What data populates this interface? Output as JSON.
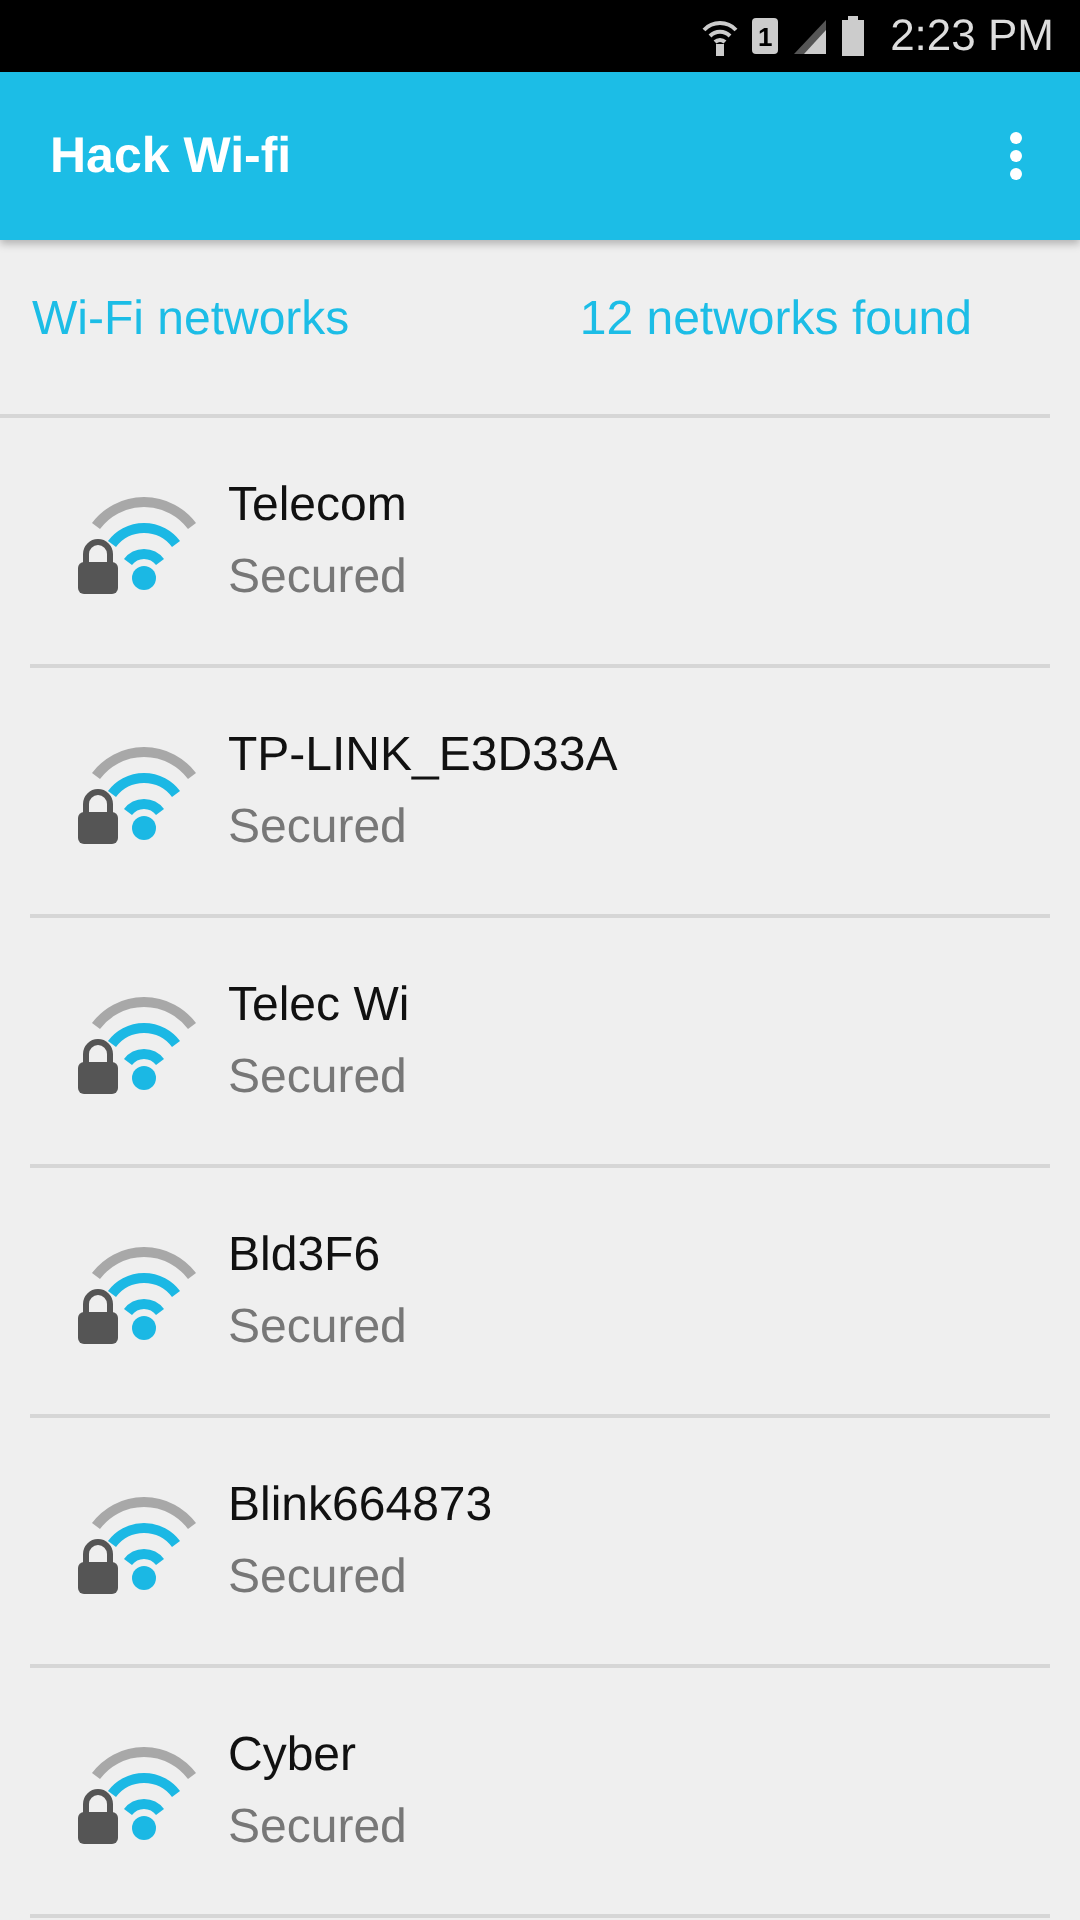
{
  "status_bar": {
    "sim": "1",
    "time": "2:23 PM"
  },
  "app_bar": {
    "title": "Hack Wi-fi"
  },
  "header": {
    "title": "Wi-Fi networks",
    "count": "12 networks found"
  },
  "networks": [
    {
      "name": "Telecom",
      "status": "Secured"
    },
    {
      "name": "TP-LINK_E3D33A",
      "status": "Secured"
    },
    {
      "name": "Telec Wi",
      "status": "Secured"
    },
    {
      "name": "Bld3F6",
      "status": "Secured"
    },
    {
      "name": "Blink664873",
      "status": "Secured"
    },
    {
      "name": "Cyber",
      "status": "Secured"
    }
  ]
}
